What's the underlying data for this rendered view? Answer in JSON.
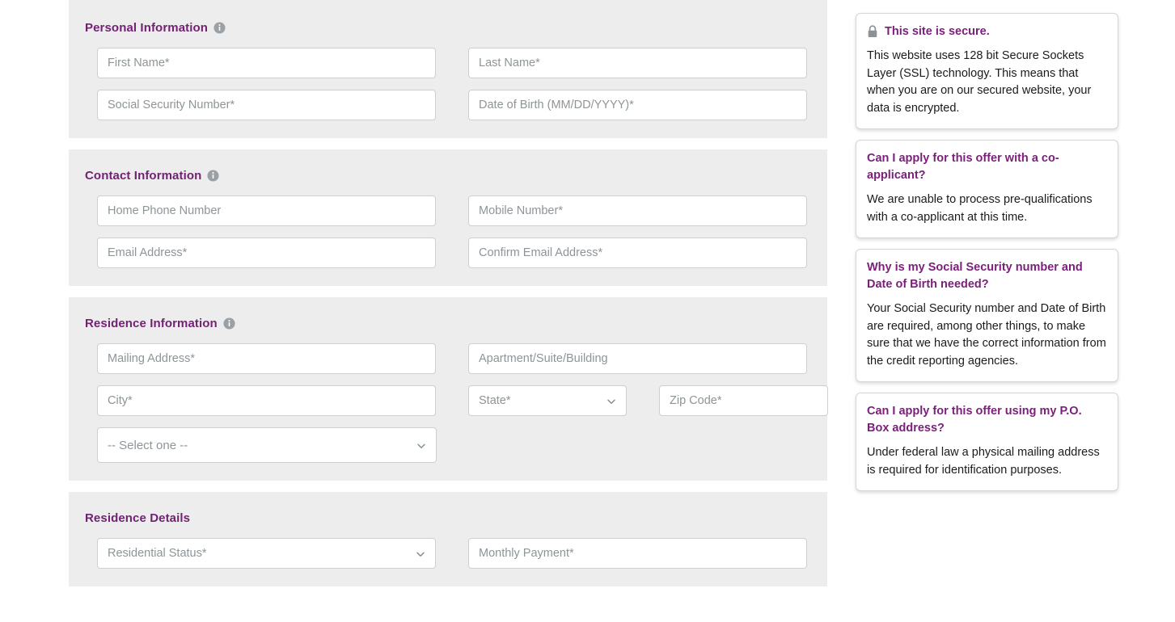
{
  "colors": {
    "heading_purple": "#722272",
    "card_title_purple": "#7a1f7a",
    "section_bg": "#ededed",
    "placeholder": "#8d9598",
    "field_border": "#cfcfcf"
  },
  "form": {
    "sections": [
      {
        "title": "Personal Information",
        "info_icon": "info-circle-icon",
        "has_info": true,
        "fields": [
          {
            "name": "first-name",
            "placeholder": "First Name*",
            "type": "text"
          },
          {
            "name": "last-name",
            "placeholder": "Last Name*",
            "type": "text"
          },
          {
            "name": "social-security-number",
            "placeholder": "Social Security Number*",
            "type": "text"
          },
          {
            "name": "date-of-birth",
            "placeholder": "Date of Birth (MM/DD/YYYY)*",
            "type": "text"
          }
        ]
      },
      {
        "title": "Contact Information",
        "info_icon": "info-circle-icon",
        "has_info": true,
        "fields": [
          {
            "name": "home-phone-number",
            "placeholder": "Home Phone Number",
            "type": "text"
          },
          {
            "name": "mobile-number",
            "placeholder": "Mobile Number*",
            "type": "text"
          },
          {
            "name": "email-address",
            "placeholder": "Email Address*",
            "type": "text"
          },
          {
            "name": "confirm-email-address",
            "placeholder": "Confirm Email Address*",
            "type": "text"
          }
        ]
      },
      {
        "title": "Residence Information",
        "info_icon": "info-circle-icon",
        "has_info": true,
        "fields": [
          {
            "name": "mailing-address",
            "placeholder": "Mailing Address*",
            "type": "text"
          },
          {
            "name": "apartment-suite-building",
            "placeholder": "Apartment/Suite/Building",
            "type": "text"
          },
          {
            "name": "city",
            "placeholder": "City*",
            "type": "text"
          },
          {
            "name": "state",
            "placeholder": "State*",
            "type": "select"
          },
          {
            "name": "zip-code",
            "placeholder": "Zip Code*",
            "type": "text"
          },
          {
            "name": "residence-select-one",
            "placeholder": "-- Select one --",
            "type": "select"
          }
        ]
      },
      {
        "title": "Residence Details",
        "has_info": false,
        "fields": [
          {
            "name": "residential-status",
            "placeholder": "Residential Status*",
            "type": "select"
          },
          {
            "name": "monthly-payment",
            "placeholder": "Monthly Payment*",
            "type": "text"
          }
        ]
      }
    ]
  },
  "info_cards": [
    {
      "icon": "lock-icon",
      "title": "This site is secure.",
      "body": "This website uses 128 bit Secure Sockets Layer (SSL) technology. This means that when you are on our secured website, your data is encrypted."
    },
    {
      "title": "Can I apply for this offer with a co-applicant?",
      "body": "We are unable to process pre-qualifications with a co-applicant at this time."
    },
    {
      "title": "Why is my Social Security number and Date of Birth needed?",
      "body": "Your Social Security number and Date of Birth are required, among other things, to make sure that we have the correct information from the credit reporting agencies."
    },
    {
      "title": "Can I apply for this offer using my P.O. Box address?",
      "body": "Under federal law a physical mailing address is required for identification purposes."
    }
  ]
}
